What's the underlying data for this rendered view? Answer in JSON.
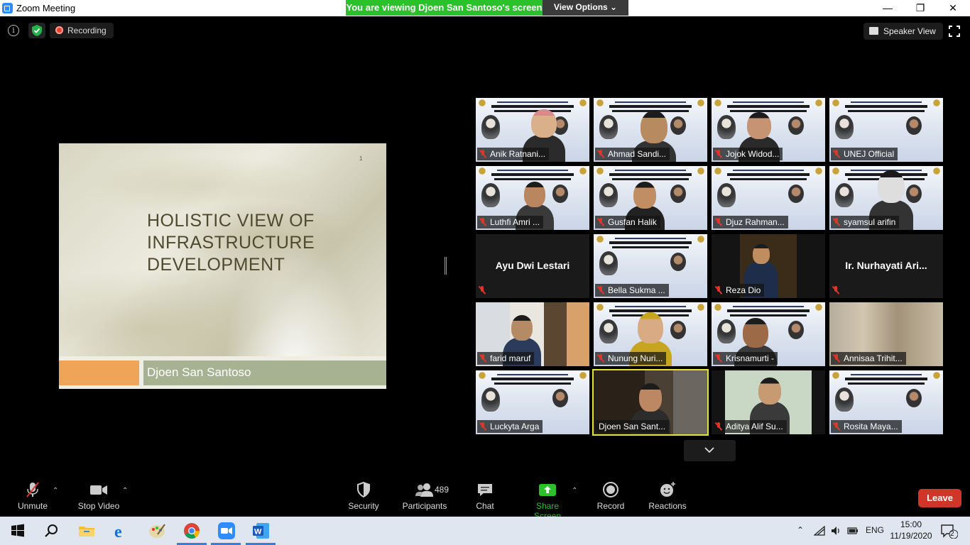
{
  "window": {
    "title": "Zoom Meeting"
  },
  "banner": {
    "viewing": "You are viewing Djoen San Santoso's screen",
    "view_options": "View Options ⌄"
  },
  "window_controls": {
    "minimize": "—",
    "restore": "❐",
    "close": "✕"
  },
  "top_bar": {
    "info": "i",
    "recording": "Recording",
    "speaker_view": "Speaker View"
  },
  "slide": {
    "page_number": "1",
    "title_lines": [
      "HOLISTIC VIEW OF",
      "INFRASTRUCTURE",
      "DEVELOPMENT"
    ],
    "presenter": "Djoen San Santoso"
  },
  "participants": [
    {
      "name": "Anik Ratnani...",
      "muted": true,
      "video": "slide"
    },
    {
      "name": "Ahmad Sandi...",
      "muted": true,
      "video": "slide"
    },
    {
      "name": "Jojok Widod...",
      "muted": true,
      "video": "slide"
    },
    {
      "name": "UNEJ Official",
      "muted": true,
      "video": "slide"
    },
    {
      "name": "Luthfi Amri ...",
      "muted": true,
      "video": "slide"
    },
    {
      "name": "Gusfan Halik",
      "muted": true,
      "video": "slide"
    },
    {
      "name": "Djuz Rahman...",
      "muted": true,
      "video": "slide"
    },
    {
      "name": "syamsul arifin",
      "muted": true,
      "video": "slide"
    },
    {
      "name": "Ayu Dwi Lestari",
      "muted": true,
      "video": "off"
    },
    {
      "name": "Bella Sukma ...",
      "muted": true,
      "video": "slide"
    },
    {
      "name": "Reza Dio",
      "muted": true,
      "video": "camera"
    },
    {
      "name": "Ir. Nurhayati Ari...",
      "muted": true,
      "video": "off"
    },
    {
      "name": "farid maruf",
      "muted": true,
      "video": "camera"
    },
    {
      "name": "Nunung Nuri...",
      "muted": true,
      "video": "slide"
    },
    {
      "name": "Krisnamurti -",
      "muted": true,
      "video": "slide"
    },
    {
      "name": "Annisaa Trihit...",
      "muted": true,
      "video": "camera"
    },
    {
      "name": "Luckyta Arga",
      "muted": true,
      "video": "slide"
    },
    {
      "name": "Djoen San Sant...",
      "muted": false,
      "video": "camera",
      "active_speaker": true
    },
    {
      "name": "Aditya Alif Su...",
      "muted": true,
      "video": "camera"
    },
    {
      "name": "Rosita Maya...",
      "muted": true,
      "video": "slide"
    }
  ],
  "toolbar": {
    "unmute": "Unmute",
    "stop_video": "Stop Video",
    "security": "Security",
    "participants": "Participants",
    "participants_count": "489",
    "chat": "Chat",
    "share_screen": "Share Screen",
    "record": "Record",
    "reactions": "Reactions",
    "leave": "Leave"
  },
  "taskbar": {
    "language": "ENG",
    "time": "15:00",
    "date": "11/19/2020",
    "notifications": "2"
  },
  "colors": {
    "banner_green": "#2bc12b",
    "leave_red": "#d03628",
    "share_green": "#2bc12b",
    "speaker_highlight": "#e3e33b"
  }
}
